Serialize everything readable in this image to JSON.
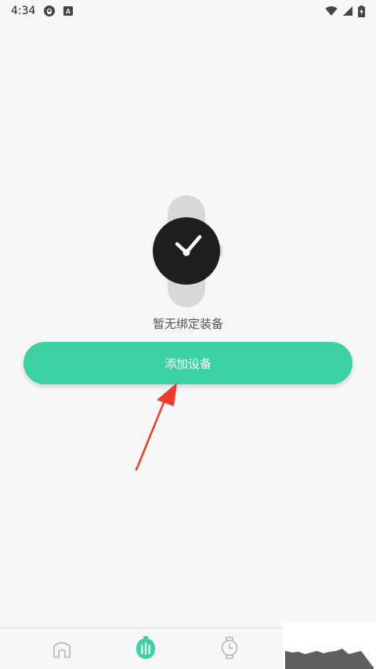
{
  "status_bar": {
    "time": "4:34",
    "left_icons": [
      "qq-notification-icon",
      "a-notification-icon"
    ],
    "right_icons": [
      "wifi-icon",
      "signal-icon",
      "battery-charging-icon"
    ],
    "notification_letter": "A"
  },
  "empty_state": {
    "illustration": "watch-illustration",
    "message": "暂无绑定装备"
  },
  "actions": {
    "add_device_label": "添加设备"
  },
  "annotation": {
    "arrow_color": "#f03a2a"
  },
  "bottom_nav": {
    "items": [
      {
        "icon": "home-icon",
        "active": false
      },
      {
        "icon": "health-icon",
        "active": true
      },
      {
        "icon": "watch-icon",
        "active": false
      }
    ]
  },
  "colors": {
    "accent": "#3bd1a2",
    "background": "#f7f7f7",
    "watch_face": "#1e1e1e",
    "watch_strap": "#d8d8d8"
  }
}
